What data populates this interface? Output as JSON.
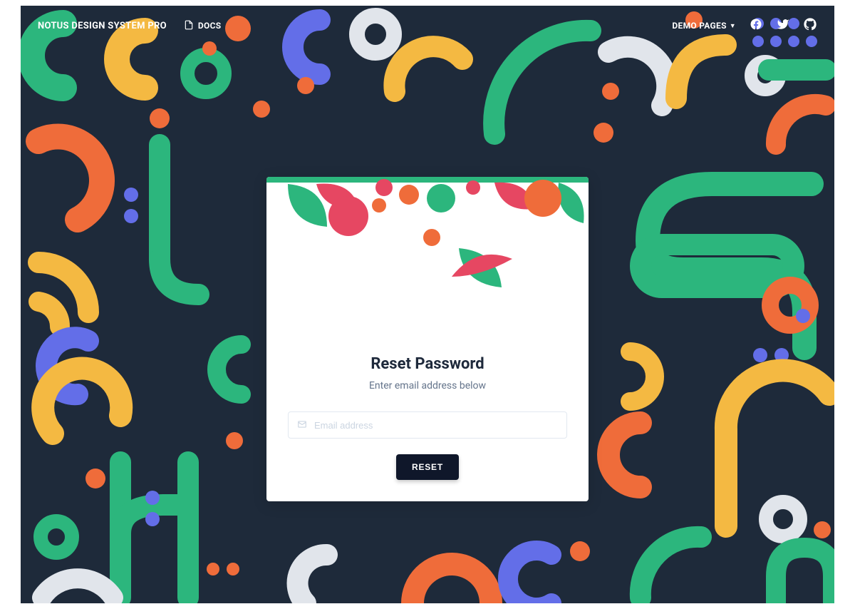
{
  "navbar": {
    "brand": "NOTUS DESIGN SYSTEM PRO",
    "docs_label": "DOCS",
    "demo_pages_label": "DEMO PAGES"
  },
  "card": {
    "title": "Reset Password",
    "subtitle": "Enter email address below",
    "email_placeholder": "Email address",
    "reset_button": "RESET"
  },
  "colors": {
    "bg": "#1e2a3a",
    "green": "#2cb67d",
    "yellow": "#f4b942",
    "orange": "#ef6c3a",
    "indigo": "#636ee8",
    "light": "#e1e5eb",
    "crimson": "#e64762"
  }
}
